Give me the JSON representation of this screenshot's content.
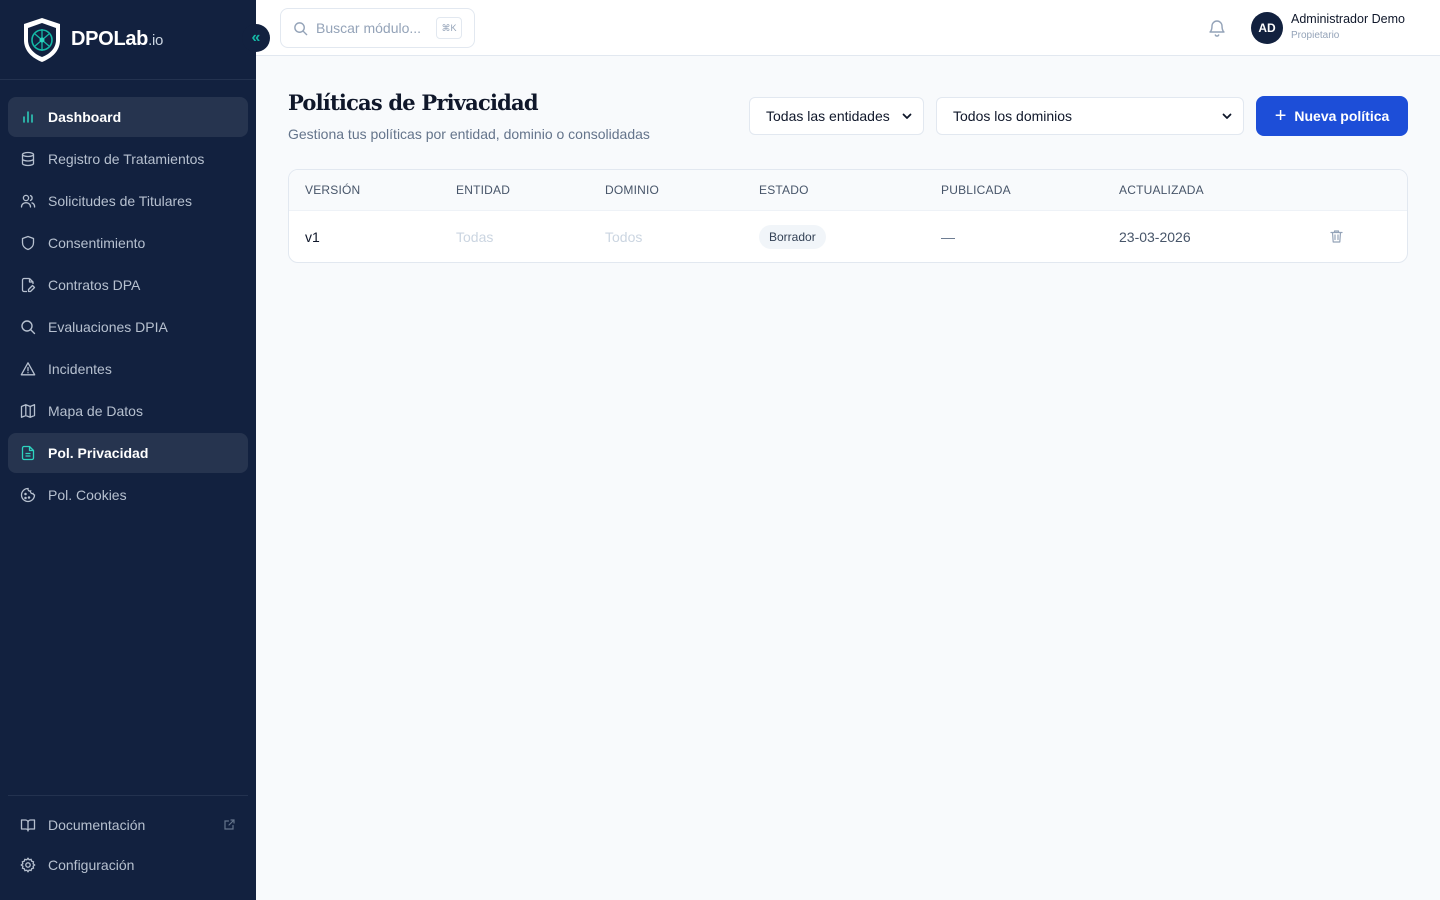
{
  "brand": {
    "name": "DPOLab",
    "tld": ".io"
  },
  "sidebar": {
    "collapse_icon": "«",
    "items": [
      {
        "label": "Dashboard",
        "icon": "bar-chart-icon",
        "active": true
      },
      {
        "label": "Registro de Tratamientos",
        "icon": "database-icon"
      },
      {
        "label": "Solicitudes de Titulares",
        "icon": "users-icon"
      },
      {
        "label": "Consentimiento",
        "icon": "shield-icon"
      },
      {
        "label": "Contratos DPA",
        "icon": "file-edit-icon"
      },
      {
        "label": "Evaluaciones DPIA",
        "icon": "search-icon"
      },
      {
        "label": "Incidentes",
        "icon": "alert-triangle-icon"
      },
      {
        "label": "Mapa de Datos",
        "icon": "map-icon"
      },
      {
        "label": "Pol. Privacidad",
        "icon": "file-text-icon",
        "active": true
      },
      {
        "label": "Pol. Cookies",
        "icon": "cookie-icon"
      }
    ],
    "footer": [
      {
        "label": "Documentación",
        "icon": "book-open-icon"
      },
      {
        "label": "Configuración",
        "icon": "gear-icon"
      }
    ]
  },
  "topbar": {
    "search_placeholder": "Buscar módulo...",
    "shortcut": "⌘K",
    "user": {
      "initials": "AD",
      "name": "Administrador Demo",
      "role": "Propietario"
    }
  },
  "main": {
    "title": "Políticas de Privacidad",
    "subtitle": "Gestiona tus políticas por entidad, dominio o consolidadas",
    "filters": {
      "entities": "Todas las entidades",
      "domains": "Todos los dominios"
    },
    "new_button": "Nueva política",
    "table": {
      "headers": [
        "VERSIÓN",
        "ENTIDAD",
        "DOMINIO",
        "ESTADO",
        "PUBLICADA",
        "ACTUALIZADA"
      ],
      "rows": [
        {
          "version": "v1",
          "entity": "Todas",
          "domain": "Todos",
          "status": "Borrador",
          "published": "—",
          "updated": "23-03-2026"
        }
      ]
    }
  },
  "colors": {
    "sidebar_bg": "#12213f",
    "accent_teal": "#2dd4bf",
    "primary_blue": "#1d4ed8"
  }
}
